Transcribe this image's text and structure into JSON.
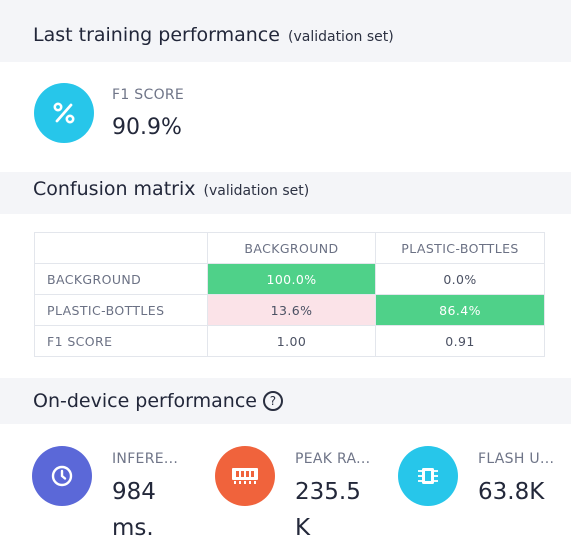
{
  "training": {
    "title": "Last training performance",
    "subtitle": "(validation set)",
    "f1": {
      "icon": "percent-icon",
      "label": "F1 SCORE",
      "value": "90.9%"
    }
  },
  "confusion": {
    "title": "Confusion matrix",
    "subtitle": "(validation set)",
    "columns": [
      "BACKGROUND",
      "PLASTIC-BOTTLES"
    ],
    "rows": [
      {
        "label": "BACKGROUND",
        "cells": [
          "100.0%",
          "0.0%"
        ]
      },
      {
        "label": "PLASTIC-BOTTLES",
        "cells": [
          "13.6%",
          "86.4%"
        ]
      },
      {
        "label": "F1 SCORE",
        "cells": [
          "1.00",
          "0.91"
        ]
      }
    ],
    "colors": {
      "correct": "#4fd189",
      "error": "#fbe3e8"
    }
  },
  "device": {
    "title": "On-device performance",
    "help_icon": "help-circle-icon",
    "metrics": [
      {
        "icon": "clock-icon",
        "label": "INFERE...",
        "value_line1": "984",
        "value_line2": "ms.",
        "color": "#5b68d8"
      },
      {
        "icon": "memory-icon",
        "label": "PEAK RA...",
        "value_line1": "235.5",
        "value_line2": "K",
        "color": "#f0633c"
      },
      {
        "icon": "chip-icon",
        "label": "FLASH U...",
        "value_line1": "63.8K",
        "value_line2": "",
        "color": "#27c6ea"
      }
    ]
  },
  "colors": {
    "accent_cyan": "#27c6ea"
  }
}
